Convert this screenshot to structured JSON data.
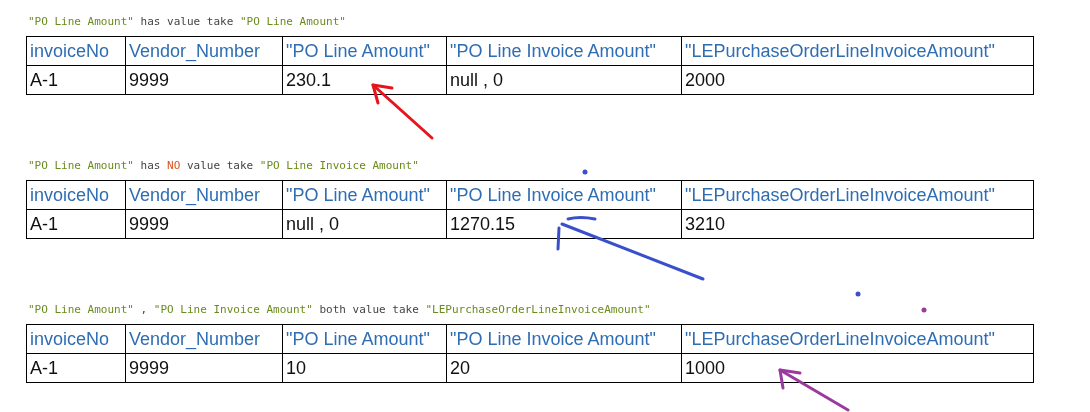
{
  "sections": [
    {
      "caption": [
        {
          "kind": "string",
          "text": "\"PO Line Amount\""
        },
        {
          "kind": "plain",
          "text": " has value take "
        },
        {
          "kind": "string",
          "text": "\"PO Line Amount\""
        }
      ],
      "columns": [
        "invoiceNo",
        "Vendor_Number",
        "\"PO Line Amount\"",
        "\"PO Line Invoice Amount\"",
        "\"LEPurchaseOrderLineInvoiceAmount\""
      ],
      "rows": [
        [
          "A-1",
          "9999",
          "230.1",
          "null , 0",
          "2000"
        ]
      ],
      "arrow": {
        "color": "#e8141c"
      }
    },
    {
      "caption": [
        {
          "kind": "string",
          "text": "\"PO Line Amount\""
        },
        {
          "kind": "plain",
          "text": " has "
        },
        {
          "kind": "keyword",
          "text": "NO"
        },
        {
          "kind": "plain",
          "text": " value take "
        },
        {
          "kind": "string",
          "text": "\"PO Line Invoice Amount\""
        }
      ],
      "columns": [
        "invoiceNo",
        "Vendor_Number",
        "\"PO Line Amount\"",
        "\"PO Line Invoice Amount\"",
        "\"LEPurchaseOrderLineInvoiceAmount\""
      ],
      "rows": [
        [
          "A-1",
          "9999",
          "null , 0",
          "1270.15",
          "3210"
        ]
      ],
      "arrow": {
        "color": "#3a4fcc"
      }
    },
    {
      "caption": [
        {
          "kind": "string",
          "text": "\"PO Line Amount\""
        },
        {
          "kind": "plain",
          "text": " , "
        },
        {
          "kind": "string",
          "text": "\"PO Line Invoice Amount\""
        },
        {
          "kind": "plain",
          "text": " both value take "
        },
        {
          "kind": "string",
          "text": "\"LEPurchaseOrderLineInvoiceAmount\""
        }
      ],
      "columns": [
        "invoiceNo",
        "Vendor_Number",
        "\"PO Line Amount\"",
        "\"PO Line Invoice Amount\"",
        "\"LEPurchaseOrderLineInvoiceAmount\""
      ],
      "rows": [
        [
          "A-1",
          "9999",
          "10",
          "20",
          "1000"
        ]
      ],
      "arrow": {
        "color": "#9b3a9e"
      }
    }
  ]
}
